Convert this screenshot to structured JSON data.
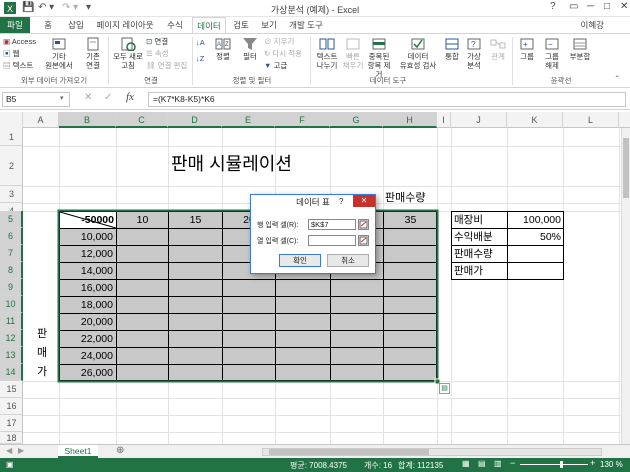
{
  "app": {
    "window_title": "가상분석 (예제) - Excel",
    "user_name": "이혜강",
    "window_controls": [
      "?",
      "─",
      "□",
      "✕"
    ]
  },
  "ribbon_tabs": [
    {
      "label": "파일"
    },
    {
      "label": "홈"
    },
    {
      "label": "삽입"
    },
    {
      "label": "페이지 레이아웃"
    },
    {
      "label": "수식"
    },
    {
      "label": "데이터"
    },
    {
      "label": "검토"
    },
    {
      "label": "보기"
    },
    {
      "label": "개발 도구"
    }
  ],
  "ribbon": {
    "external": {
      "access": "Access",
      "web": "웹",
      "text": "텍스트",
      "other_1": "기타",
      "other_2": "원본에서",
      "existing_1": "기존",
      "existing_2": "연결",
      "group": "외부 데이터 가져오기"
    },
    "connections": {
      "refresh_1": "모두 새로",
      "refresh_2": "고침",
      "connect": "연결",
      "properties": "속성",
      "edit_links": "연결 편집",
      "group": "연결"
    },
    "sort_filter": {
      "sort": "정렬",
      "filter": "필터",
      "clear": "지우기",
      "reapply": "다시 적용",
      "advanced": "고급",
      "group": "정렬 및 필터"
    },
    "data_tools": {
      "text_to_col_1": "텍스트",
      "text_to_col_2": "나누기",
      "flash_1": "빠른",
      "flash_2": "채우기",
      "dup_1": "중복된",
      "dup_2": "항목 제거",
      "valid_1": "데이터",
      "valid_2": "유효성 검사",
      "group": "데이터 도구"
    },
    "analysis": {
      "consolidate": "통합",
      "whatif_1": "가상",
      "whatif_2": "분석",
      "relations": "관계"
    },
    "outline": {
      "group_btn": "그룹",
      "ungroup_1": "그룹",
      "ungroup_2": "해제",
      "subtotal": "부분합",
      "group": "윤곽선"
    }
  },
  "formula_bar": {
    "name_box": "B5",
    "fx": "fx",
    "formula": "=(K7*K8-K5)*K6"
  },
  "columns": [
    "A",
    "B",
    "C",
    "D",
    "E",
    "F",
    "G",
    "H",
    "I",
    "J",
    "K",
    "L"
  ],
  "rows": [
    "1",
    "2",
    "3",
    "4",
    "5",
    "6",
    "7",
    "8",
    "9",
    "10",
    "11",
    "12",
    "13",
    "14",
    "15",
    "16",
    "17",
    "18"
  ],
  "sheet": {
    "title": "판매 시뮬레이션",
    "col_var_label": "판매수량",
    "row_var_label": [
      "판",
      "매",
      "가"
    ],
    "corner_value": "-50000",
    "header_values": [
      "10",
      "15",
      "20",
      "",
      "",
      "",
      "35"
    ],
    "row_values": [
      "10,000",
      "12,000",
      "14,000",
      "16,000",
      "18,000",
      "20,000",
      "22,000",
      "24,000",
      "26,000"
    ],
    "side_table": [
      {
        "label": "매장비",
        "value": "100,000"
      },
      {
        "label": "수익배분",
        "value": "50%"
      },
      {
        "label": "판매수량",
        "value": ""
      },
      {
        "label": "판매가",
        "value": ""
      }
    ]
  },
  "dialog": {
    "title": "데이터 표",
    "help": "?",
    "close": "✕",
    "row_input_label": "행 입력 셀(R):",
    "row_input_value": "$K$7",
    "col_input_label": "열 입력 셀(C):",
    "col_input_value": "",
    "ok": "확인",
    "cancel": "취소"
  },
  "sheet_tabs": [
    {
      "label": "Sheet1"
    }
  ],
  "status": {
    "average": "평균: 7008.4375",
    "count": "개수: 16",
    "sum": "합계: 112135",
    "zoom": "130 %"
  },
  "colors": {
    "accent": "#217346",
    "selection_fill": "#c8c8c8",
    "dialog_close": "#c7312b"
  }
}
